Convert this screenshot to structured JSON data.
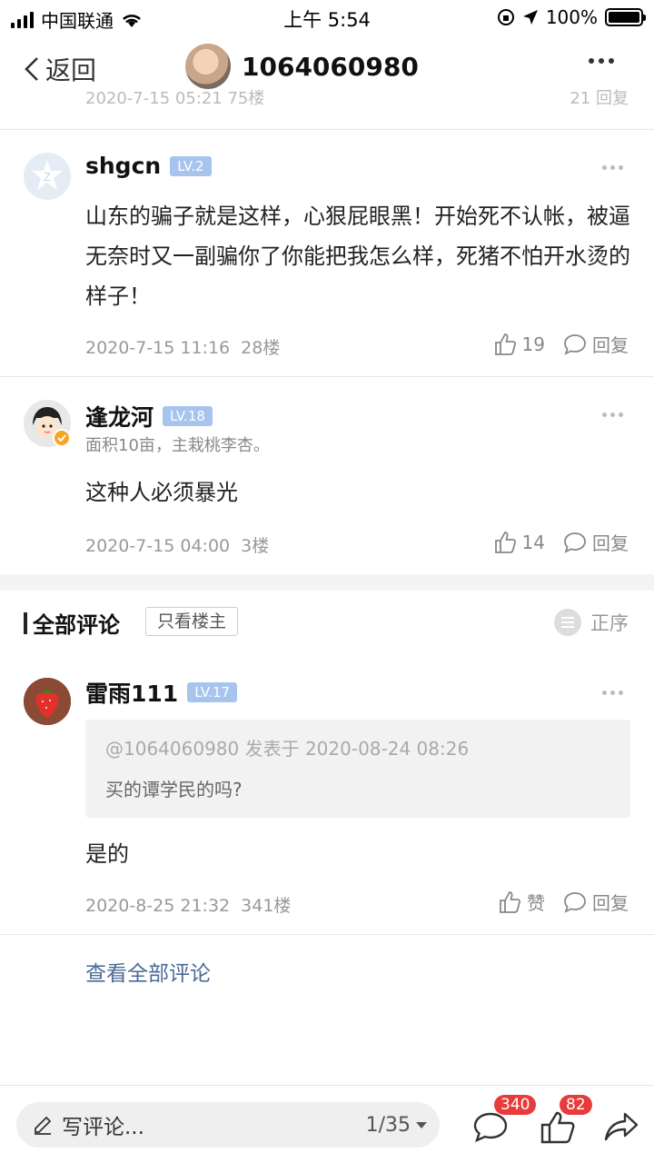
{
  "status_bar": {
    "carrier": "中国联通",
    "time": "上午 5:54",
    "battery": "100%"
  },
  "nav": {
    "back_label": "返回",
    "title": "1064060980"
  },
  "peek": {
    "left": "2020-7-15 05:21 75楼",
    "right": "21  回复"
  },
  "comments": [
    {
      "name": "shgcn",
      "level": "LV.2",
      "body": "山东的骗子就是这样，心狠屁眼黑！开始死不认帐，被逼无奈时又一副骗你了你能把我怎么样，死猪不怕开水烫的样子！",
      "time": "2020-7-15 11:16",
      "floor": "28楼",
      "likes": "19",
      "reply_label": "回复"
    },
    {
      "name": "逢龙河",
      "level": "LV.18",
      "subtitle": "面积10亩，主栽桃李杏。",
      "body": "这种人必须暴光",
      "time": "2020-7-15 04:00",
      "floor": "3楼",
      "likes": "14",
      "reply_label": "回复"
    }
  ],
  "section": {
    "title": "全部评论",
    "owner_only": "只看楼主",
    "sort_label": "正序"
  },
  "reply": {
    "name": "雷雨111",
    "level": "LV.17",
    "quote_meta": "@1064060980 发表于 2020-08-24 08:26",
    "quote_text": "买的谭学民的吗?",
    "body": "是的",
    "time": "2020-8-25 21:32",
    "floor": "341楼",
    "like_label": "赞",
    "reply_label": "回复"
  },
  "view_all": "查看全部评论",
  "bottom": {
    "placeholder": "写评论...",
    "page": "1/35",
    "comment_count": "340",
    "like_count": "82"
  },
  "colors": {
    "level_badge": "#a7c4ef",
    "badge_red": "#e83c3c",
    "link_blue": "#4a6a97"
  }
}
